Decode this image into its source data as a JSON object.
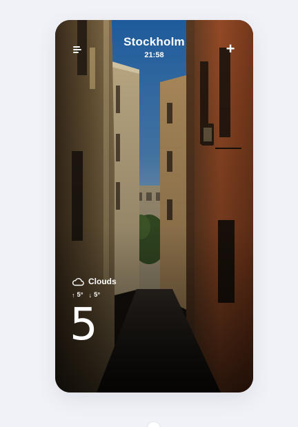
{
  "header": {
    "city": "Stockholm",
    "time": "21:58",
    "menu_icon": "hamburger-menu-icon",
    "add_icon": "plus-icon",
    "add_glyph": "+"
  },
  "weather": {
    "condition": "Clouds",
    "condition_icon": "cloud-icon",
    "max_temp": "5°",
    "min_temp": "5°",
    "temperature": "5"
  },
  "colors": {
    "page_background": "#f1f2f7",
    "text": "#ffffff",
    "sky": "#2f6fb0",
    "facade_left": "#6b5637",
    "facade_right": "#a8532a"
  }
}
